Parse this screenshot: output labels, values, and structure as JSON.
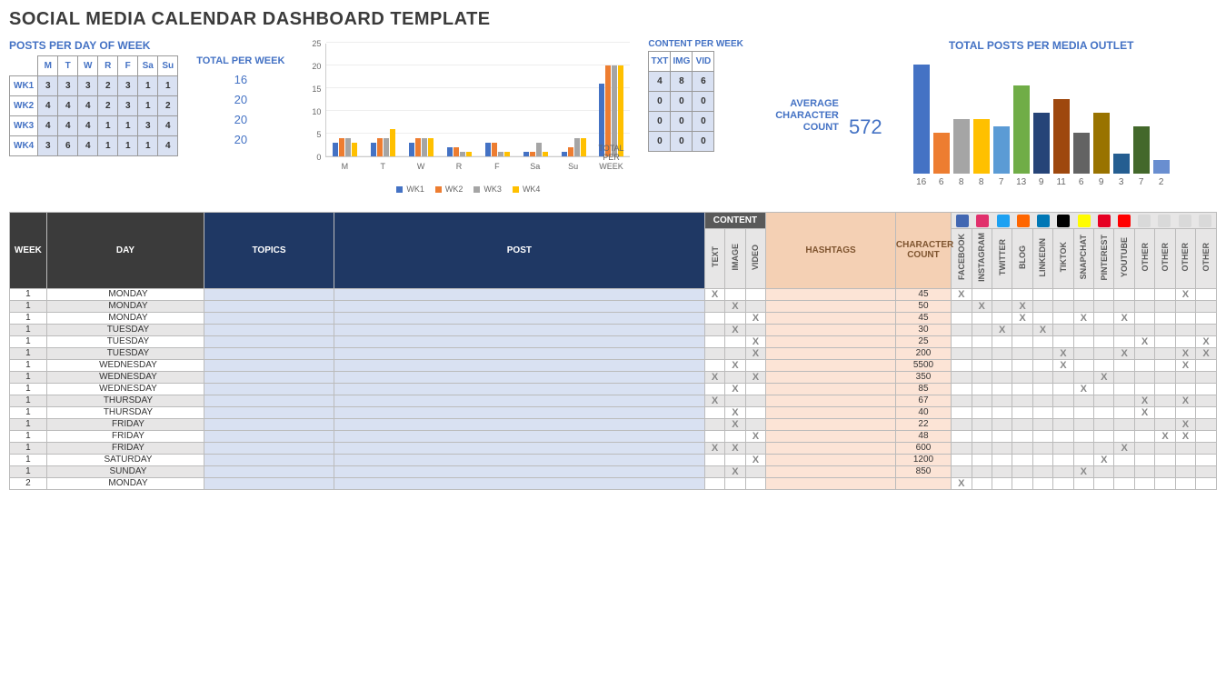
{
  "title": "SOCIAL MEDIA CALENDAR DASHBOARD TEMPLATE",
  "posts_per_day": {
    "title": "POSTS PER DAY OF WEEK",
    "cols": [
      "M",
      "T",
      "W",
      "R",
      "F",
      "Sa",
      "Su"
    ],
    "rows": [
      "WK1",
      "WK2",
      "WK3",
      "WK4"
    ],
    "data": [
      [
        3,
        3,
        3,
        2,
        3,
        1,
        1
      ],
      [
        4,
        4,
        4,
        2,
        3,
        1,
        2
      ],
      [
        4,
        4,
        4,
        1,
        1,
        3,
        4
      ],
      [
        3,
        6,
        4,
        1,
        1,
        1,
        4
      ]
    ],
    "total_label": "TOTAL PER WEEK",
    "totals": [
      16,
      20,
      20,
      20
    ]
  },
  "chart_data": {
    "type": "bar",
    "series": [
      {
        "name": "WK1",
        "values": [
          3,
          3,
          3,
          2,
          3,
          1,
          1,
          16
        ],
        "color": "#4472c4"
      },
      {
        "name": "WK2",
        "values": [
          4,
          4,
          4,
          2,
          3,
          1,
          2,
          20
        ],
        "color": "#ed7d31"
      },
      {
        "name": "WK3",
        "values": [
          4,
          4,
          4,
          1,
          1,
          3,
          4,
          20
        ],
        "color": "#a5a5a5"
      },
      {
        "name": "WK4",
        "values": [
          3,
          6,
          4,
          1,
          1,
          1,
          4,
          20
        ],
        "color": "#ffc000"
      }
    ],
    "categories": [
      "M",
      "T",
      "W",
      "R",
      "F",
      "Sa",
      "Su",
      "TOTAL PER WEEK"
    ],
    "ylim": [
      0,
      25
    ],
    "yticks": [
      0,
      5,
      10,
      15,
      20,
      25
    ]
  },
  "content_per_week": {
    "title": "CONTENT PER WEEK",
    "cols": [
      "TXT",
      "IMG",
      "VID"
    ],
    "data": [
      [
        4,
        8,
        6
      ],
      [
        0,
        0,
        0
      ],
      [
        0,
        0,
        0
      ],
      [
        0,
        0,
        0
      ]
    ]
  },
  "avg_char": {
    "label": "AVERAGE CHARACTER COUNT",
    "value": "572"
  },
  "chart2": {
    "title": "TOTAL POSTS PER MEDIA OUTLET",
    "values": [
      16,
      6,
      8,
      8,
      7,
      13,
      9,
      11,
      6,
      9,
      3,
      7,
      2
    ],
    "colors": [
      "#4472c4",
      "#ed7d31",
      "#a5a5a5",
      "#ffc000",
      "#5b9bd5",
      "#70ad47",
      "#264478",
      "#9e480e",
      "#636363",
      "#997300",
      "#255e91",
      "#43682b",
      "#698ed0"
    ]
  },
  "headers": {
    "week": "WEEK",
    "day": "DAY",
    "topics": "TOPICS",
    "post": "POST",
    "content": "CONTENT",
    "text": "TEXT",
    "image": "IMAGE",
    "video": "VIDEO",
    "hashtags": "HASHTAGS",
    "charcount": "CHARACTER COUNT",
    "media": [
      "FACEBOOK",
      "INSTAGRAM",
      "TWITTER",
      "BLOG",
      "LINKEDIN",
      "TIKTOK",
      "SNAPCHAT",
      "PINTEREST",
      "YOUTUBE",
      "OTHER",
      "OTHER",
      "OTHER",
      "OTHER"
    ]
  },
  "media_icons": [
    {
      "name": "facebook-icon",
      "color": "#4267B2"
    },
    {
      "name": "instagram-icon",
      "color": "#e1306c"
    },
    {
      "name": "twitter-icon",
      "color": "#1DA1F2"
    },
    {
      "name": "blog-icon",
      "color": "#ff6600"
    },
    {
      "name": "linkedin-icon",
      "color": "#0077b5"
    },
    {
      "name": "tiktok-icon",
      "color": "#000000"
    },
    {
      "name": "snapchat-icon",
      "color": "#fffc00"
    },
    {
      "name": "pinterest-icon",
      "color": "#e60023"
    },
    {
      "name": "youtube-icon",
      "color": "#ff0000"
    },
    {
      "name": "other1-icon",
      "color": "#d9d9d9"
    },
    {
      "name": "other2-icon",
      "color": "#d9d9d9"
    },
    {
      "name": "other3-icon",
      "color": "#d9d9d9"
    },
    {
      "name": "other4-icon",
      "color": "#d9d9d9"
    }
  ],
  "rows": [
    {
      "week": 1,
      "day": "MONDAY",
      "text": "X",
      "image": "",
      "video": "",
      "cc": 45,
      "m": [
        "X",
        "",
        "",
        "",
        "",
        "",
        "",
        "",
        "",
        "",
        "",
        "X",
        ""
      ]
    },
    {
      "week": 1,
      "day": "MONDAY",
      "text": "",
      "image": "X",
      "video": "",
      "cc": 50,
      "m": [
        "",
        "X",
        "",
        "X",
        "",
        "",
        "",
        "",
        "",
        "",
        "",
        "",
        ""
      ]
    },
    {
      "week": 1,
      "day": "MONDAY",
      "text": "",
      "image": "",
      "video": "X",
      "cc": 45,
      "m": [
        "",
        "",
        "",
        "X",
        "",
        "",
        "X",
        "",
        "X",
        "",
        "",
        "",
        ""
      ]
    },
    {
      "week": 1,
      "day": "TUESDAY",
      "text": "",
      "image": "X",
      "video": "",
      "cc": 30,
      "m": [
        "",
        "",
        "X",
        "",
        "X",
        "",
        "",
        "",
        "",
        "",
        "",
        "",
        ""
      ]
    },
    {
      "week": 1,
      "day": "TUESDAY",
      "text": "",
      "image": "",
      "video": "X",
      "cc": 25,
      "m": [
        "",
        "",
        "",
        "",
        "",
        "",
        "",
        "",
        "",
        "X",
        "",
        "",
        "X"
      ]
    },
    {
      "week": 1,
      "day": "TUESDAY",
      "text": "",
      "image": "",
      "video": "X",
      "cc": 200,
      "m": [
        "",
        "",
        "",
        "",
        "",
        "X",
        "",
        "",
        "X",
        "",
        "",
        "X",
        "X"
      ]
    },
    {
      "week": 1,
      "day": "WEDNESDAY",
      "text": "",
      "image": "X",
      "video": "",
      "cc": 5500,
      "m": [
        "",
        "",
        "",
        "",
        "",
        "X",
        "",
        "",
        "",
        "",
        "",
        "X",
        ""
      ]
    },
    {
      "week": 1,
      "day": "WEDNESDAY",
      "text": "X",
      "image": "",
      "video": "X",
      "cc": 350,
      "m": [
        "",
        "",
        "",
        "",
        "",
        "",
        "",
        "X",
        "",
        "",
        "",
        "",
        ""
      ]
    },
    {
      "week": 1,
      "day": "WEDNESDAY",
      "text": "",
      "image": "X",
      "video": "",
      "cc": 85,
      "m": [
        "",
        "",
        "",
        "",
        "",
        "",
        "X",
        "",
        "",
        "",
        "",
        "",
        ""
      ]
    },
    {
      "week": 1,
      "day": "THURSDAY",
      "text": "X",
      "image": "",
      "video": "",
      "cc": 67,
      "m": [
        "",
        "",
        "",
        "",
        "",
        "",
        "",
        "",
        "",
        "X",
        "",
        "X",
        ""
      ]
    },
    {
      "week": 1,
      "day": "THURSDAY",
      "text": "",
      "image": "X",
      "video": "",
      "cc": 40,
      "m": [
        "",
        "",
        "",
        "",
        "",
        "",
        "",
        "",
        "",
        "X",
        "",
        "",
        ""
      ]
    },
    {
      "week": 1,
      "day": "FRIDAY",
      "text": "",
      "image": "X",
      "video": "",
      "cc": 22,
      "m": [
        "",
        "",
        "",
        "",
        "",
        "",
        "",
        "",
        "",
        "",
        "",
        "X",
        ""
      ]
    },
    {
      "week": 1,
      "day": "FRIDAY",
      "text": "",
      "image": "",
      "video": "X",
      "cc": 48,
      "m": [
        "",
        "",
        "",
        "",
        "",
        "",
        "",
        "",
        "",
        "",
        "X",
        "X",
        ""
      ]
    },
    {
      "week": 1,
      "day": "FRIDAY",
      "text": "X",
      "image": "X",
      "video": "",
      "cc": 600,
      "m": [
        "",
        "",
        "",
        "",
        "",
        "",
        "",
        "",
        "X",
        "",
        "",
        "",
        ""
      ]
    },
    {
      "week": 1,
      "day": "SATURDAY",
      "text": "",
      "image": "",
      "video": "X",
      "cc": 1200,
      "m": [
        "",
        "",
        "",
        "",
        "",
        "",
        "",
        "X",
        "",
        "",
        "",
        "",
        ""
      ]
    },
    {
      "week": 1,
      "day": "SUNDAY",
      "text": "",
      "image": "X",
      "video": "",
      "cc": 850,
      "m": [
        "",
        "",
        "",
        "",
        "",
        "",
        "X",
        "",
        "",
        "",
        "",
        "",
        ""
      ]
    },
    {
      "week": 2,
      "day": "MONDAY",
      "text": "",
      "image": "",
      "video": "",
      "cc": "",
      "m": [
        "X",
        "",
        "",
        "",
        "",
        "",
        "",
        "",
        "",
        "",
        "",
        "",
        ""
      ]
    }
  ]
}
